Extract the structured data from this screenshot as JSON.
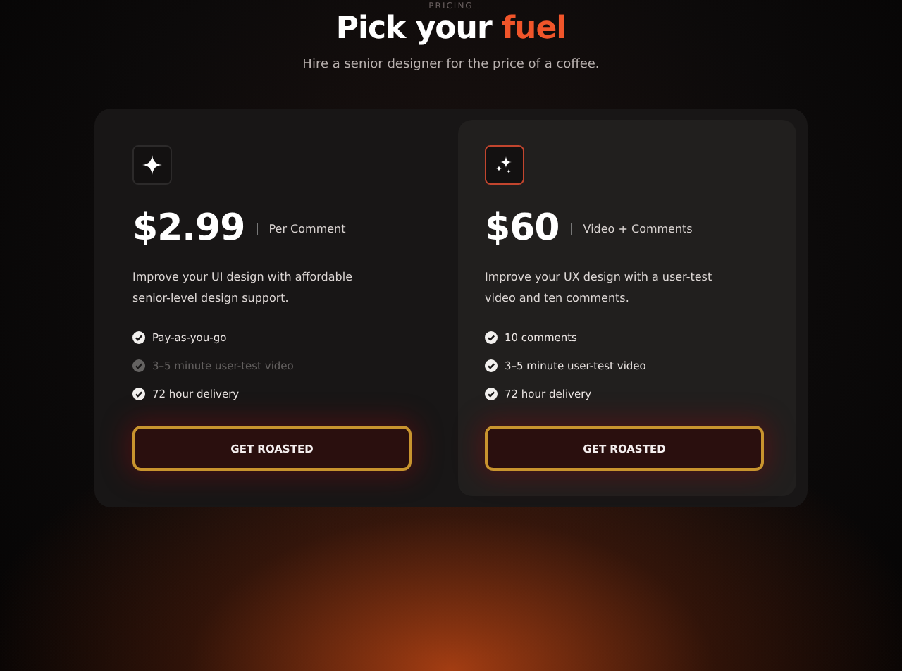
{
  "eyebrow": "PRICING",
  "title": "Pick your",
  "title_accent": "fuel",
  "subtitle": "Hire a senior designer for the price of a coffee.",
  "plans": [
    {
      "featured": false,
      "price": "$2.99",
      "unit": "Per Comment",
      "description": "Improve your UI design with affordable senior-level design support.",
      "features": [
        {
          "label": "Pay-as-you-go",
          "included": true
        },
        {
          "label": "3–5 minute user-test video",
          "included": false
        },
        {
          "label": "72 hour delivery",
          "included": true
        }
      ],
      "button": "GET ROASTED"
    },
    {
      "featured": true,
      "price": "$60",
      "unit": "Video + Comments",
      "description": "Improve your UX design with a user-test video and ten comments.",
      "features": [
        {
          "label": "10 comments",
          "included": true
        },
        {
          "label": "3–5 minute user-test video",
          "included": true
        },
        {
          "label": "72 hour delivery",
          "included": true
        }
      ],
      "button": "GET ROASTED"
    }
  ]
}
